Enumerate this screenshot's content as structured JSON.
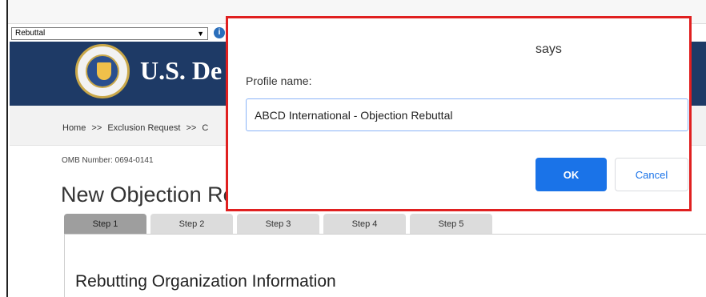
{
  "toolbar": {
    "profile_select_value": "Rebuttal",
    "info_icon": "info-icon"
  },
  "header": {
    "title": "U.S. De",
    "seal_icon": "department-seal-icon"
  },
  "breadcrumb": {
    "items": [
      "Home",
      ">>",
      "Exclusion Request",
      ">>",
      "C"
    ]
  },
  "page": {
    "omb_number": "OMB Number: 0694-0141",
    "title": "New Objection Re",
    "section_title": "Rebutting Organization Information"
  },
  "tabs": [
    {
      "label": "Step 1",
      "active": true
    },
    {
      "label": "Step 2",
      "active": false
    },
    {
      "label": "Step 3",
      "active": false
    },
    {
      "label": "Step 4",
      "active": false
    },
    {
      "label": "Step 5",
      "active": false
    }
  ],
  "dialog": {
    "says": "says",
    "label": "Profile name:",
    "input_value": "ABCD International - Objection Rebuttal",
    "ok_label": "OK",
    "cancel_label": "Cancel",
    "highlight_color": "#e02020",
    "primary_color": "#1a73e8"
  },
  "colors": {
    "header_bg": "#1e3a66"
  }
}
